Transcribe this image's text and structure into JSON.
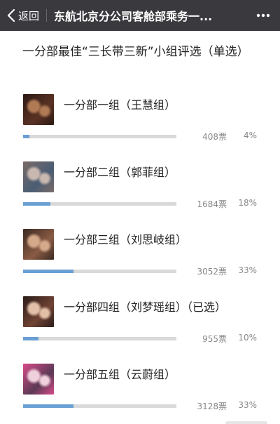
{
  "header": {
    "back_label": "返回",
    "title": "东航北京分公司客舱部乘务一..."
  },
  "poll": {
    "question": "一分部最佳“三长带三新”小组评选（单选）",
    "options": [
      {
        "label": "一分部一组（王慧组）",
        "votes": "408票",
        "percent": "4%",
        "fill": 0.04,
        "thumb_colors": [
          "#2b1a14",
          "#b07a55",
          "#5a3224"
        ]
      },
      {
        "label": "一分部二组（郭菲组）",
        "votes": "1684票",
        "percent": "18%",
        "fill": 0.18,
        "thumb_colors": [
          "#7a6b66",
          "#c9b8b0",
          "#4a5d74"
        ]
      },
      {
        "label": "一分部三组（刘思岐组）",
        "votes": "3052票",
        "percent": "33%",
        "fill": 0.33,
        "thumb_colors": [
          "#3b2a22",
          "#d3a98a",
          "#8a5b44"
        ]
      },
      {
        "label": "一分部四组（刘梦瑶组）（已选）",
        "votes": "955票",
        "percent": "10%",
        "fill": 0.1,
        "thumb_colors": [
          "#2a1c18",
          "#e2c0a8",
          "#704334"
        ]
      },
      {
        "label": "一分部五组（云蔚组）",
        "votes": "3128票",
        "percent": "33%",
        "fill": 0.33,
        "thumb_colors": [
          "#d84a8a",
          "#f0d0dc",
          "#5b3a55"
        ]
      }
    ]
  },
  "colors": {
    "topbar": "#3a3a3e",
    "bar_fill": "#6a9fd3",
    "bar_track": "#d9d9d9"
  },
  "icons": {
    "back": "chevron-left-icon",
    "more": "more-dots-icon"
  }
}
